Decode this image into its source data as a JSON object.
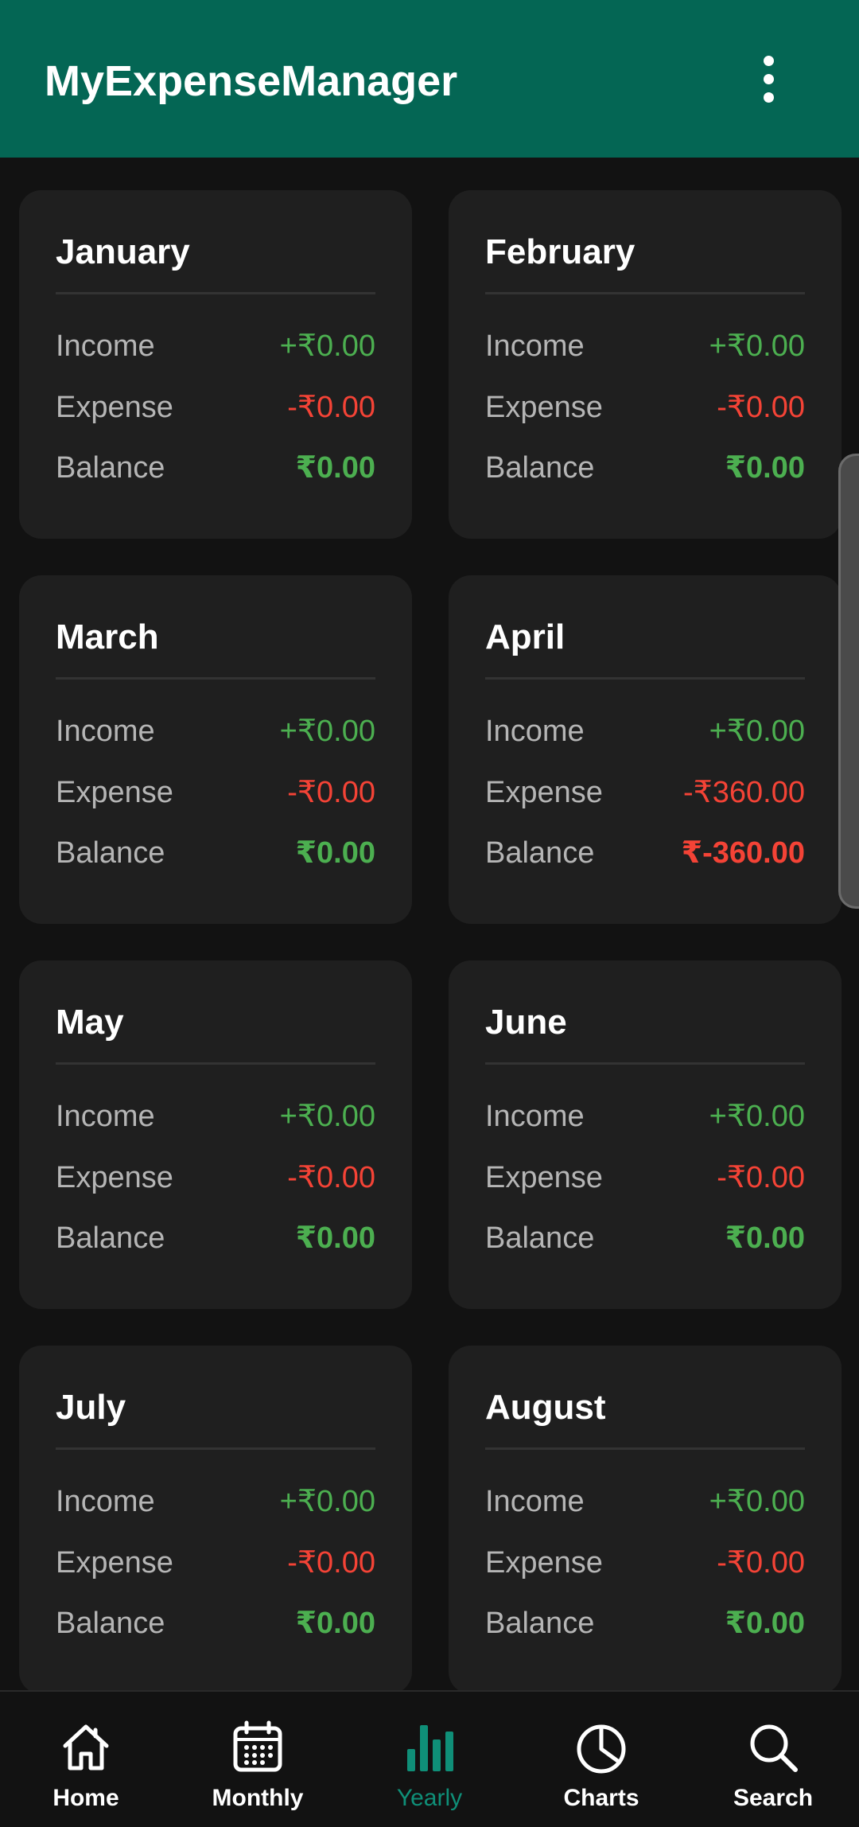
{
  "app": {
    "title": "MyExpenseManager"
  },
  "colors": {
    "appbar": "#046654",
    "background": "#121212",
    "card": "#1f1f1f",
    "income": "#4caf50",
    "expense": "#f44336",
    "active_nav": "#0f8f78"
  },
  "labels": {
    "income": "Income",
    "expense": "Expense",
    "balance": "Balance"
  },
  "months": [
    {
      "name": "January",
      "income": "+₹0.00",
      "expense": "-₹0.00",
      "balance": "₹0.00",
      "balance_negative": false
    },
    {
      "name": "February",
      "income": "+₹0.00",
      "expense": "-₹0.00",
      "balance": "₹0.00",
      "balance_negative": false
    },
    {
      "name": "March",
      "income": "+₹0.00",
      "expense": "-₹0.00",
      "balance": "₹0.00",
      "balance_negative": false
    },
    {
      "name": "April",
      "income": "+₹0.00",
      "expense": "-₹360.00",
      "balance": "₹-360.00",
      "balance_negative": true
    },
    {
      "name": "May",
      "income": "+₹0.00",
      "expense": "-₹0.00",
      "balance": "₹0.00",
      "balance_negative": false
    },
    {
      "name": "June",
      "income": "+₹0.00",
      "expense": "-₹0.00",
      "balance": "₹0.00",
      "balance_negative": false
    },
    {
      "name": "July",
      "income": "+₹0.00",
      "expense": "-₹0.00",
      "balance": "₹0.00",
      "balance_negative": false
    },
    {
      "name": "August",
      "income": "+₹0.00",
      "expense": "-₹0.00",
      "balance": "₹0.00",
      "balance_negative": false
    }
  ],
  "bottom_nav": {
    "items": [
      {
        "label": "Home",
        "icon": "home-icon",
        "active": false
      },
      {
        "label": "Monthly",
        "icon": "calendar-icon",
        "active": false
      },
      {
        "label": "Yearly",
        "icon": "bar-chart-icon",
        "active": true
      },
      {
        "label": "Charts",
        "icon": "pie-chart-icon",
        "active": false
      },
      {
        "label": "Search",
        "icon": "search-icon",
        "active": false
      }
    ]
  }
}
